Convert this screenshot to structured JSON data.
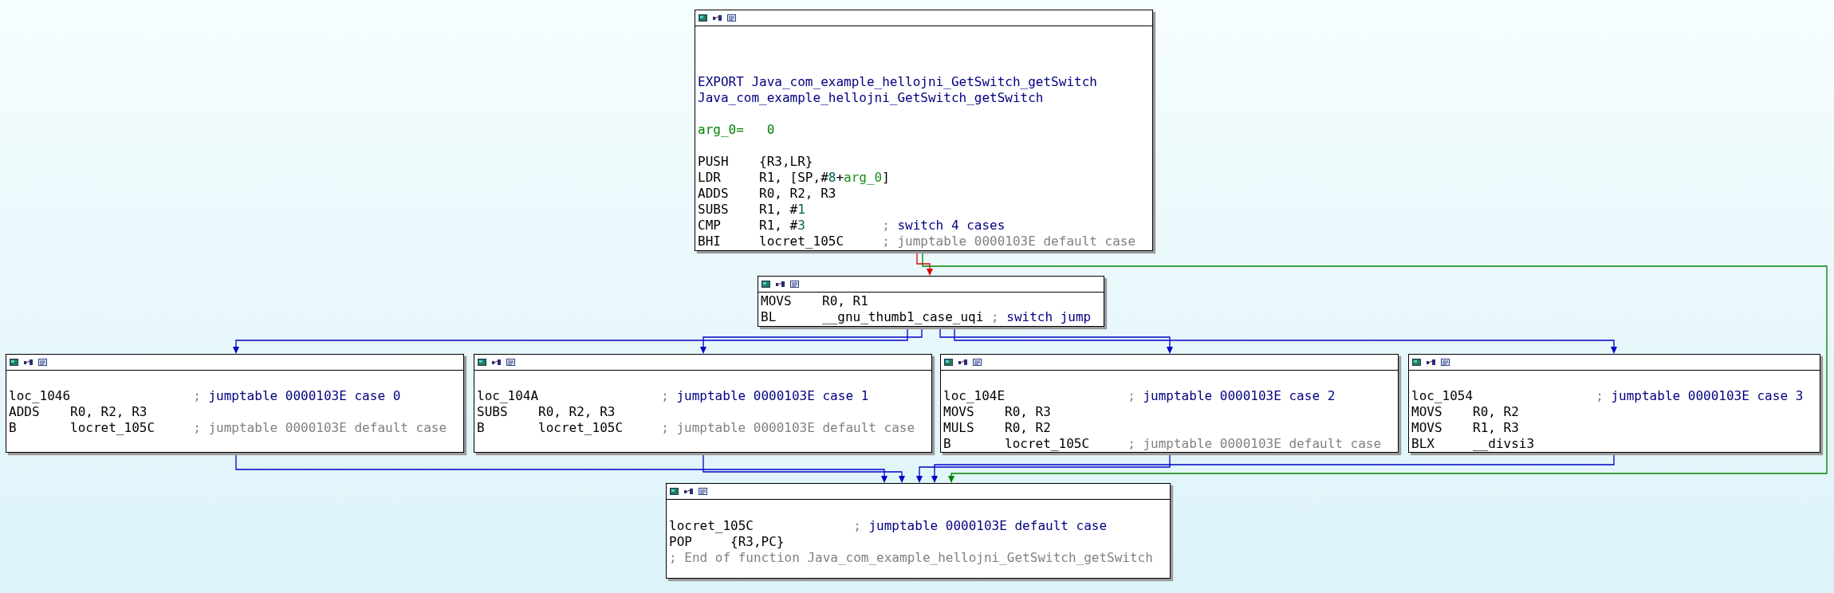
{
  "nodes": [
    {
      "lines": [
        {
          "kind": "blank"
        },
        {
          "kind": "blank"
        },
        {
          "kind": "blank"
        },
        {
          "kind": "export",
          "text": "EXPORT Java_com_example_hellojni_GetSwitch_getSwitch"
        },
        {
          "kind": "name",
          "text": "Java_com_example_hellojni_GetSwitch_getSwitch"
        },
        {
          "kind": "blank"
        },
        {
          "kind": "var",
          "name": "arg_0=",
          "value": "0"
        },
        {
          "kind": "blank"
        },
        {
          "kind": "insn",
          "mnemonic": "PUSH",
          "operands": [
            {
              "text": "{R3,LR}"
            }
          ]
        },
        {
          "kind": "insn",
          "mnemonic": "LDR",
          "operands": [
            {
              "text": "R1, [SP,#"
            },
            {
              "text": "8",
              "kind": "num"
            },
            {
              "text": "+"
            },
            {
              "text": "arg_0",
              "kind": "var"
            },
            {
              "text": "]"
            }
          ]
        },
        {
          "kind": "insn",
          "mnemonic": "ADDS",
          "operands": [
            {
              "text": "R0, R2, R3"
            }
          ]
        },
        {
          "kind": "insn",
          "mnemonic": "SUBS",
          "operands": [
            {
              "text": "R1, #"
            },
            {
              "text": "1",
              "kind": "num"
            }
          ]
        },
        {
          "kind": "insn",
          "mnemonic": "CMP",
          "operands": [
            {
              "text": "R1, #"
            },
            {
              "text": "3",
              "kind": "num"
            }
          ],
          "comment": {
            "marker": ";",
            "text": "switch 4 cases",
            "kind": "name"
          }
        },
        {
          "kind": "insn",
          "mnemonic": "BHI",
          "operands": [
            {
              "text": "locret_105C"
            }
          ],
          "comment": {
            "marker": ";",
            "text": "jumptable 0000103E default case",
            "kind": "auto"
          }
        }
      ]
    },
    {
      "lines": [
        {
          "kind": "insn",
          "mnemonic": "MOVS",
          "operands": [
            {
              "text": "R0, R1"
            }
          ]
        },
        {
          "kind": "insn",
          "mnemonic": "BL",
          "operands": [
            {
              "text": "__gnu_thumb1_case_uqi"
            }
          ],
          "comment": {
            "marker": ";",
            "text": "switch jump",
            "kind": "name"
          }
        }
      ]
    },
    {
      "lines": [
        {
          "kind": "blank"
        },
        {
          "kind": "label",
          "text": "loc_1046",
          "comment": {
            "marker": ";",
            "text": "jumptable 0000103E case 0",
            "kind": "name"
          }
        },
        {
          "kind": "insn",
          "mnemonic": "ADDS",
          "operands": [
            {
              "text": "R0, R2, R3"
            }
          ]
        },
        {
          "kind": "insn",
          "mnemonic": "B",
          "operands": [
            {
              "text": "locret_105C"
            }
          ],
          "comment": {
            "marker": ";",
            "text": "jumptable 0000103E default case",
            "kind": "auto"
          }
        }
      ]
    },
    {
      "lines": [
        {
          "kind": "blank"
        },
        {
          "kind": "label",
          "text": "loc_104A",
          "comment": {
            "marker": ";",
            "text": "jumptable 0000103E case 1",
            "kind": "name"
          }
        },
        {
          "kind": "insn",
          "mnemonic": "SUBS",
          "operands": [
            {
              "text": "R0, R2, R3"
            }
          ]
        },
        {
          "kind": "insn",
          "mnemonic": "B",
          "operands": [
            {
              "text": "locret_105C"
            }
          ],
          "comment": {
            "marker": ";",
            "text": "jumptable 0000103E default case",
            "kind": "auto"
          }
        }
      ]
    },
    {
      "lines": [
        {
          "kind": "blank"
        },
        {
          "kind": "label",
          "text": "loc_104E",
          "comment": {
            "marker": ";",
            "text": "jumptable 0000103E case 2",
            "kind": "name"
          }
        },
        {
          "kind": "insn",
          "mnemonic": "MOVS",
          "operands": [
            {
              "text": "R0, R3"
            }
          ]
        },
        {
          "kind": "insn",
          "mnemonic": "MULS",
          "operands": [
            {
              "text": "R0, R2"
            }
          ]
        },
        {
          "kind": "insn",
          "mnemonic": "B",
          "operands": [
            {
              "text": "locret_105C"
            }
          ],
          "comment": {
            "marker": ";",
            "text": "jumptable 0000103E default case",
            "kind": "auto"
          }
        }
      ]
    },
    {
      "lines": [
        {
          "kind": "blank"
        },
        {
          "kind": "label",
          "text": "loc_1054",
          "comment": {
            "marker": ";",
            "text": "jumptable 0000103E case 3",
            "kind": "name"
          }
        },
        {
          "kind": "insn",
          "mnemonic": "MOVS",
          "operands": [
            {
              "text": "R0, R2"
            }
          ]
        },
        {
          "kind": "insn",
          "mnemonic": "MOVS",
          "operands": [
            {
              "text": "R1, R3"
            }
          ]
        },
        {
          "kind": "insn",
          "mnemonic": "BLX",
          "operands": [
            {
              "text": "__divsi3"
            }
          ]
        }
      ]
    },
    {
      "lines": [
        {
          "kind": "blank"
        },
        {
          "kind": "label",
          "text": "locret_105C",
          "comment": {
            "marker": ";",
            "text": "jumptable 0000103E default case",
            "kind": "name"
          }
        },
        {
          "kind": "insn",
          "mnemonic": "POP",
          "operands": [
            {
              "text": "{R3,PC}"
            }
          ]
        },
        {
          "kind": "comment",
          "marker": ";",
          "text": "End of function Java_com_example_hellojni_GetSwitch_getSwitch"
        }
      ]
    }
  ],
  "edges": [
    {
      "kind": "not_taken"
    },
    {
      "kind": "taken"
    },
    {
      "kind": "jump"
    },
    {
      "kind": "jump"
    },
    {
      "kind": "jump"
    },
    {
      "kind": "jump"
    },
    {
      "kind": "jump"
    },
    {
      "kind": "jump"
    },
    {
      "kind": "jump"
    },
    {
      "kind": "jump"
    }
  ]
}
